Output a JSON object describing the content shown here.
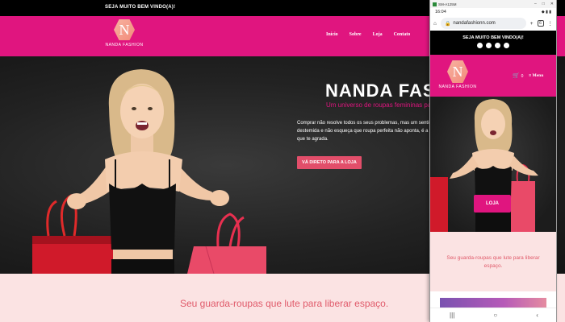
{
  "desktop": {
    "topbar": {
      "welcome": "SEJA MUITO BEM VINDO(A)!"
    },
    "logo": {
      "letter": "N",
      "text": "NANDA FASHION"
    },
    "nav": [
      "Início",
      "Sobre",
      "Loja",
      "Contato"
    ],
    "hero": {
      "title": "NANDA FASHIO",
      "subtitle": "Um universo de roupas femininas pa",
      "body": "Comprar não resolve todos os seus problemas, mas um sentir destemida e não esqueça que roupa perfeita não aponta, é a que te agrada.",
      "button": "VÁ DIRETO PARA A LOJA"
    },
    "section2": {
      "tagline": "Seu guarda-roupas que lute para liberar espaço."
    }
  },
  "phone": {
    "window_title": "SM-A125M",
    "status": {
      "time": "16:04"
    },
    "url": "nandafashionn.com",
    "tab_count": "6",
    "welcome": "SEJA MUITO BEM VINDO(A)!",
    "logo": {
      "letter": "N",
      "text": "NANDA FASHION"
    },
    "cart_count": "0",
    "menu": "Menu",
    "hero_button": "LOJA",
    "tagline": "Seu guarda-roupas que lute para liberar espaço."
  },
  "colors": {
    "brand": "#e0157f",
    "accent_button": "#e24e6a",
    "section_bg": "#fbe3e3",
    "tagline": "#e05a6a"
  }
}
